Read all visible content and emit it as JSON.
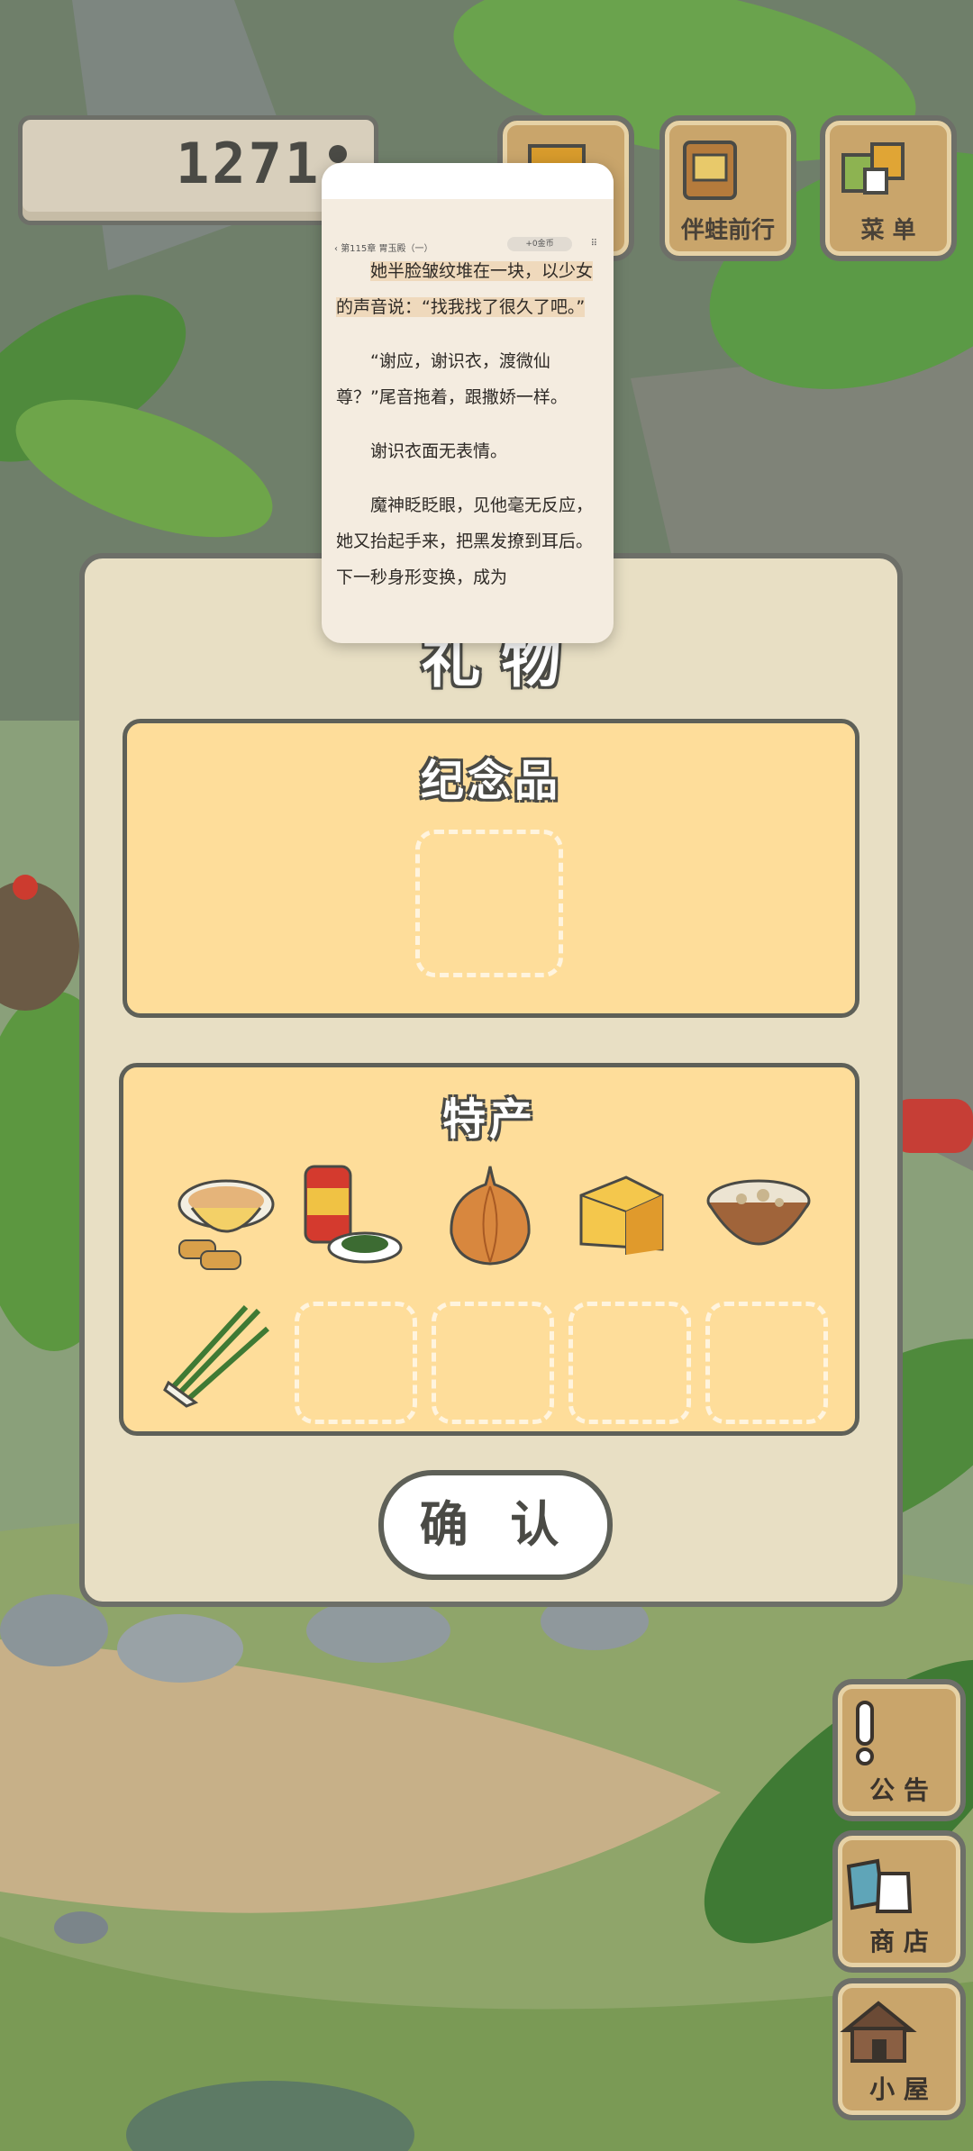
{
  "currency": {
    "count": "1271"
  },
  "top_buttons": [
    {
      "id": "tab-hidden",
      "label": ""
    },
    {
      "id": "frog-trip",
      "label": "伴蛙前行"
    },
    {
      "id": "menu",
      "label": "菜 单"
    }
  ],
  "dialog": {
    "title": "礼 物",
    "souvenir_title": "纪念品",
    "specialty_title": "特产",
    "specialty_items": [
      "tea-and-snacks-icon",
      "canned-pickles-icon",
      "onion-icon",
      "cheese-icon",
      "rice-porridge-icon",
      "green-onion-icon"
    ],
    "confirm_label": "确 认"
  },
  "reader": {
    "chapter": "第115章 胃玉殿（一）",
    "chip": "+0金币",
    "paragraphs": [
      "她半脸皱纹堆在一块，以少女的声音说：“找我找了很久了吧。”",
      "“谢应，谢识衣，渡微仙尊？”尾音拖着，跟撒娇一样。",
      "谢识衣面无表情。",
      "魔神眨眨眼，见他毫无反应，她又抬起手来，把黑发撩到耳后。下一秒身形变换，成为"
    ]
  },
  "side_buttons": [
    {
      "id": "notice",
      "label": "公 告"
    },
    {
      "id": "shop",
      "label": "商 店"
    },
    {
      "id": "house",
      "label": "小 屋"
    }
  ],
  "colors": {
    "panel": "#fedd9a",
    "dialog": "#e8dfc4",
    "border": "#6d6f68",
    "wood": "#c9a56b"
  }
}
